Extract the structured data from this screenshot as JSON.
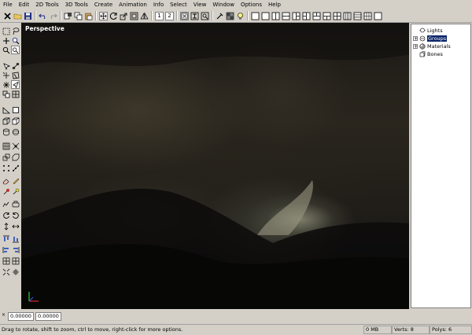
{
  "menubar": {
    "items": [
      "File",
      "Edit",
      "2D Tools",
      "3D Tools",
      "Create",
      "Animation",
      "Info",
      "Select",
      "View",
      "Window",
      "Options",
      "Help"
    ]
  },
  "toolbar": {
    "view_buttons": [
      "1",
      "2"
    ]
  },
  "viewport": {
    "label": "Perspective"
  },
  "scene_tree": {
    "items": [
      {
        "label": "Lights",
        "expandable": false,
        "icon": "light-bulb-icon",
        "selected": false
      },
      {
        "label": "Groups",
        "expandable": true,
        "icon": "group-icon",
        "selected": true
      },
      {
        "label": "Materials",
        "expandable": true,
        "icon": "material-sphere-icon",
        "selected": false
      },
      {
        "label": "Bones",
        "expandable": false,
        "icon": "bone-icon",
        "selected": false
      }
    ]
  },
  "coords": {
    "x": "0.00000",
    "y": "0.00000"
  },
  "status": {
    "message": "Drag to rotate, shift to zoom, ctrl to move, right-click for more options.",
    "memory": "0 MB",
    "verts": "Verts: 8",
    "polys": "Polys: 6"
  },
  "colors": {
    "selection": "#0a246a",
    "chrome": "#d4d0c8",
    "axis_x": "#ff3030",
    "axis_y": "#30ff30",
    "axis_z": "#3060ff"
  }
}
